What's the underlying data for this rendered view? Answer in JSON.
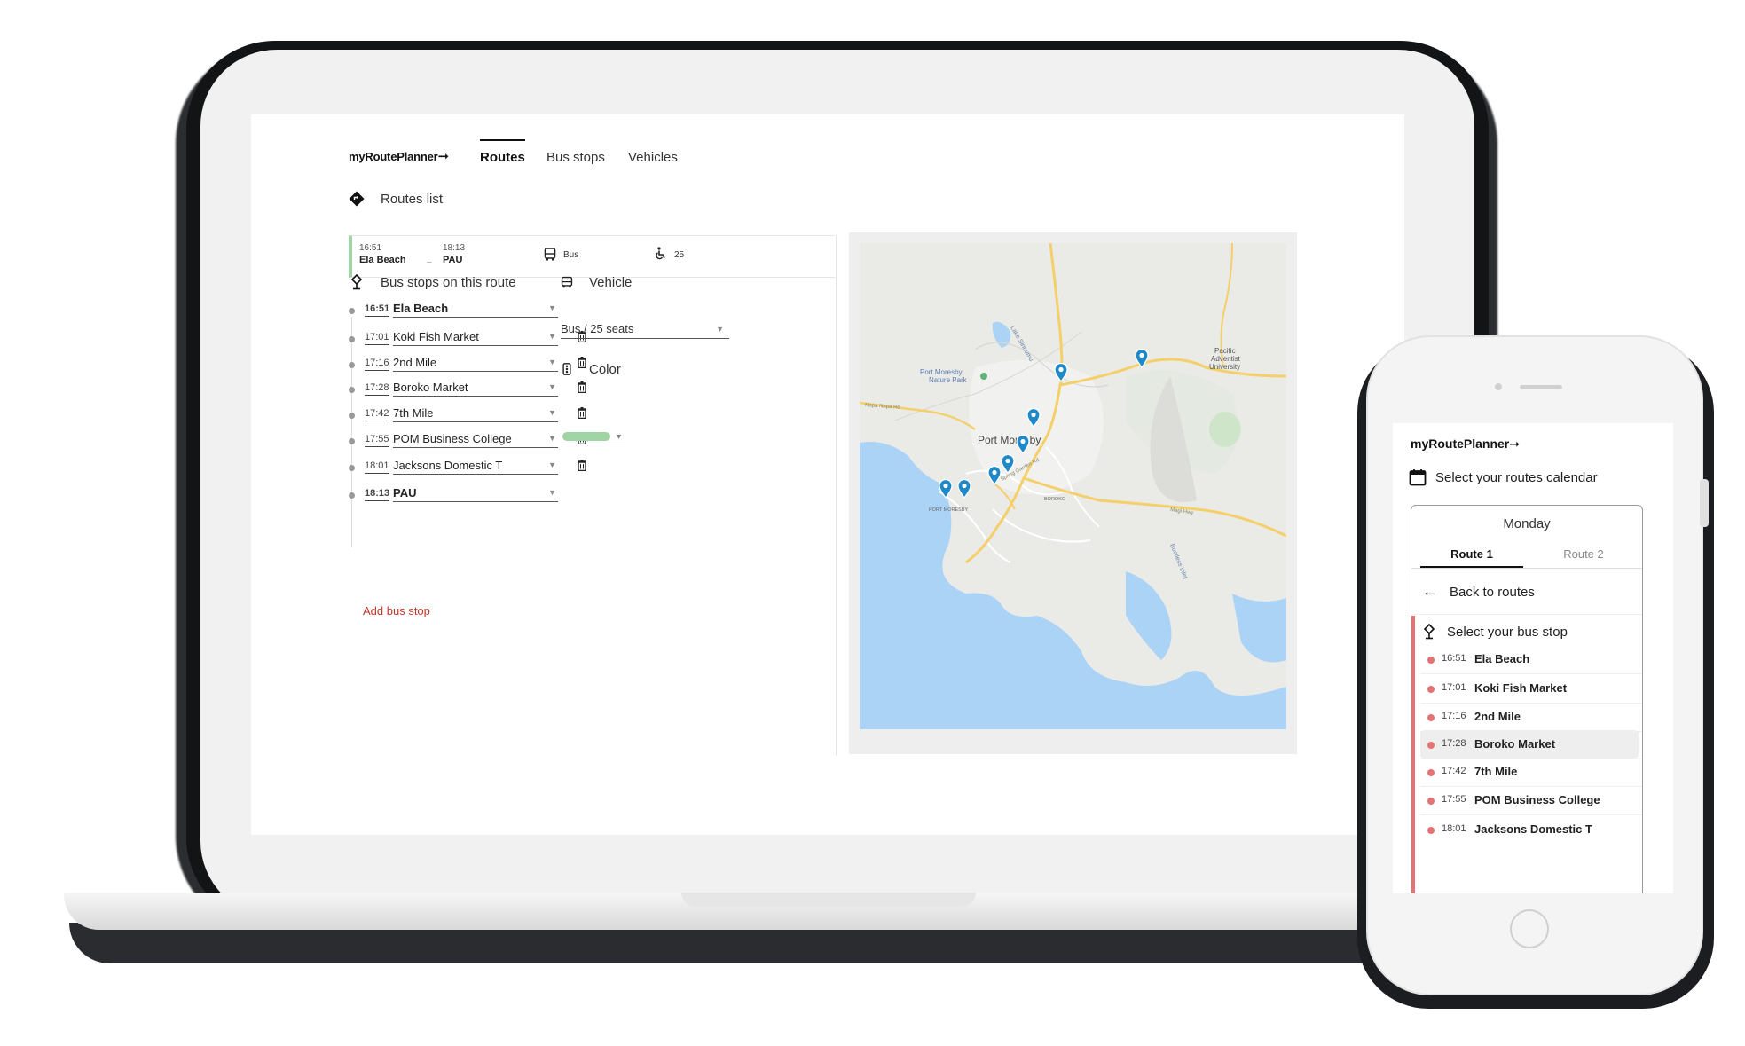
{
  "brand": {
    "name": "myRoutePlanner",
    "arrow": "➞"
  },
  "nav": {
    "tabs": [
      {
        "label": "Routes",
        "active": true
      },
      {
        "label": "Bus stops"
      },
      {
        "label": "Vehicles"
      }
    ]
  },
  "routes_list": {
    "title": "Routes list",
    "route": {
      "start_time": "16:51",
      "start_place": "Ela Beach",
      "end_time": "18:13",
      "end_place": "PAU",
      "dash": "–",
      "vehicle": "Bus",
      "seats": "25",
      "color": "#9fd4a4"
    }
  },
  "bus_stops": {
    "title": "Bus stops on this route",
    "stops": [
      {
        "time": "16:51",
        "name": "Ela Beach",
        "endpoint": true
      },
      {
        "time": "17:01",
        "name": "Koki Fish Market"
      },
      {
        "time": "17:16",
        "name": "2nd Mile"
      },
      {
        "time": "17:28",
        "name": "Boroko Market"
      },
      {
        "time": "17:42",
        "name": "7th Mile"
      },
      {
        "time": "17:55",
        "name": "POM Business College"
      },
      {
        "time": "18:01",
        "name": "Jacksons Domestic T"
      },
      {
        "time": "18:13",
        "name": "PAU",
        "endpoint": true
      }
    ],
    "add_label": "Add bus stop"
  },
  "vehicle": {
    "title": "Vehicle",
    "value": "Bus / 25 seats"
  },
  "color": {
    "title": "Color",
    "value": "#9fd4a4"
  },
  "map": {
    "labels": {
      "city": "Port Moresby",
      "park": "Port Moresby\nNature Park",
      "university": "Pacific\nAdventist\nUniversity",
      "napa": "Napa Napa Rd",
      "spring": "Spring Garden Rd",
      "magi": "Magi Hwy",
      "boroko": "BOROKO",
      "portmoresby_small": "PORT MORESBY",
      "bootless": "Bootless Inlet",
      "lake": "Lake Sirinumu"
    },
    "pin_color": "#1e88c8"
  },
  "mobile": {
    "calendar_label": "Select your routes calendar",
    "day": "Monday",
    "tabs": [
      {
        "label": "Route 1",
        "active": true
      },
      {
        "label": "Route 2"
      }
    ],
    "back_label": "Back to routes",
    "select_label": "Select your bus stop",
    "stops": [
      {
        "time": "16:51",
        "name": "Ela Beach"
      },
      {
        "time": "17:01",
        "name": "Koki Fish Market"
      },
      {
        "time": "17:16",
        "name": "2nd Mile"
      },
      {
        "time": "17:28",
        "name": "Boroko Market",
        "highlight": true
      },
      {
        "time": "17:42",
        "name": "7th Mile"
      },
      {
        "time": "17:55",
        "name": "POM Business College"
      },
      {
        "time": "18:01",
        "name": "Jacksons Domestic T"
      }
    ]
  },
  "colors": {
    "accent_green": "#9fd4a4",
    "accent_red": "#e57373",
    "link_red": "#c0392b",
    "map_water": "#aad3f5",
    "map_road": "#f5cf6a"
  }
}
